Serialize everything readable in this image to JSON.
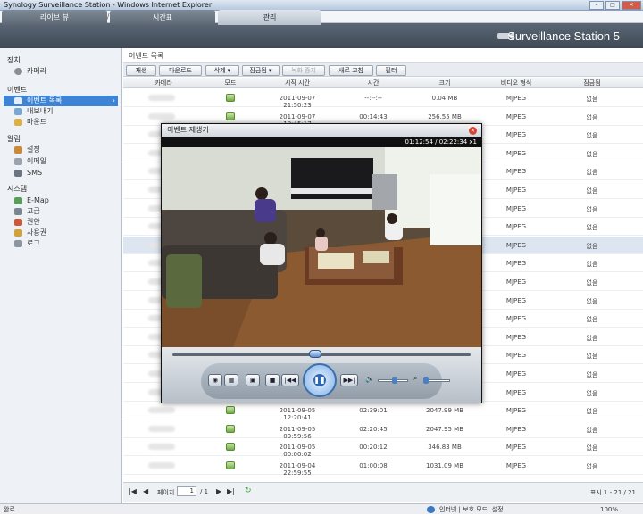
{
  "window": {
    "title": "Synology Surveillance Station - Windows Internet Explorer",
    "address": "cgi/"
  },
  "tabs": [
    {
      "label": "라이브 뷰"
    },
    {
      "label": "시간표"
    },
    {
      "label": "관리"
    }
  ],
  "brand": "Surveillance Station 5",
  "sidebar": {
    "sections": [
      {
        "title": "장치",
        "items": [
          "카메라"
        ]
      },
      {
        "title": "이벤트",
        "items": [
          "이벤트 목록",
          "내보내기",
          "마운트"
        ]
      },
      {
        "title": "알림",
        "items": [
          "설정",
          "이메일",
          "SMS"
        ]
      },
      {
        "title": "시스템",
        "items": [
          "E-Map",
          "고급",
          "권한",
          "사용권",
          "로그"
        ]
      }
    ]
  },
  "main": {
    "title": "이벤트 목록",
    "toolbar": [
      "재생",
      "다운로드",
      "삭제 ▾",
      "잠금됨 ▾",
      "녹화 중지",
      "새로 고침",
      "필터"
    ],
    "columns": [
      "카메라",
      "모드",
      "시작 시간",
      "시간",
      "크기",
      "비디오 형식",
      "잠금됨"
    ],
    "rows": [
      {
        "start": "2011-09-07 21:50:23",
        "dur": "--:--:--",
        "size": "0.04 MB",
        "fmt": "MJPEG",
        "lock": "없음"
      },
      {
        "start": "2011-09-07 19:45:17",
        "dur": "00:14:43",
        "size": "256.55 MB",
        "fmt": "MJPEG",
        "lock": "없음"
      },
      {
        "start": "",
        "dur": "",
        "size": "",
        "fmt": "MJPEG",
        "lock": "없음"
      },
      {
        "start": "",
        "dur": "",
        "size": "",
        "fmt": "MJPEG",
        "lock": "없음"
      },
      {
        "start": "",
        "dur": "",
        "size": "",
        "fmt": "MJPEG",
        "lock": "없음"
      },
      {
        "start": "",
        "dur": "",
        "size": "",
        "fmt": "MJPEG",
        "lock": "없음"
      },
      {
        "start": "",
        "dur": "",
        "size": "",
        "fmt": "MJPEG",
        "lock": "없음"
      },
      {
        "start": "",
        "dur": "",
        "size": "",
        "fmt": "MJPEG",
        "lock": "없음"
      },
      {
        "start": "",
        "dur": "",
        "size": "",
        "fmt": "MJPEG",
        "lock": "없음"
      },
      {
        "start": "",
        "dur": "",
        "size": "",
        "fmt": "MJPEG",
        "lock": "없음"
      },
      {
        "start": "",
        "dur": "",
        "size": "",
        "fmt": "MJPEG",
        "lock": "없음"
      },
      {
        "start": "",
        "dur": "",
        "size": "",
        "fmt": "MJPEG",
        "lock": "없음"
      },
      {
        "start": "",
        "dur": "",
        "size": "",
        "fmt": "MJPEG",
        "lock": "없음"
      },
      {
        "start": "",
        "dur": "",
        "size": "",
        "fmt": "MJPEG",
        "lock": "없음"
      },
      {
        "start": "",
        "dur": "",
        "size": "",
        "fmt": "MJPEG",
        "lock": "없음"
      },
      {
        "start": "",
        "dur": "",
        "size": "",
        "fmt": "MJPEG",
        "lock": "없음"
      },
      {
        "start": "",
        "dur": "",
        "size": "",
        "fmt": "MJPEG",
        "lock": "없음"
      },
      {
        "start": "2011-09-05 12:20:41",
        "dur": "02:39:01",
        "size": "2047.99 MB",
        "fmt": "MJPEG",
        "lock": "없음"
      },
      {
        "start": "2011-09-05 09:59:56",
        "dur": "02:20:45",
        "size": "2047.95 MB",
        "fmt": "MJPEG",
        "lock": "없음"
      },
      {
        "start": "2011-09-05 00:00:02",
        "dur": "00:20:12",
        "size": "346.83 MB",
        "fmt": "MJPEG",
        "lock": "없음"
      },
      {
        "start": "2011-09-04 22:59:55",
        "dur": "01:00:08",
        "size": "1031.09 MB",
        "fmt": "MJPEG",
        "lock": "없음"
      }
    ]
  },
  "pager": {
    "label": "페이지",
    "page": "1",
    "of": "/ 1",
    "summary": "표시 1 - 21 / 21"
  },
  "player": {
    "title": "이벤트 재생기",
    "time": "01:12:54 / 02:22:34  x1",
    "progress": 0.48,
    "volume": 0.55,
    "zoom": 0.1
  },
  "status": {
    "left": "완료",
    "zone": "인터넷 | 보호 모드: 설정",
    "zoom": "100%"
  }
}
